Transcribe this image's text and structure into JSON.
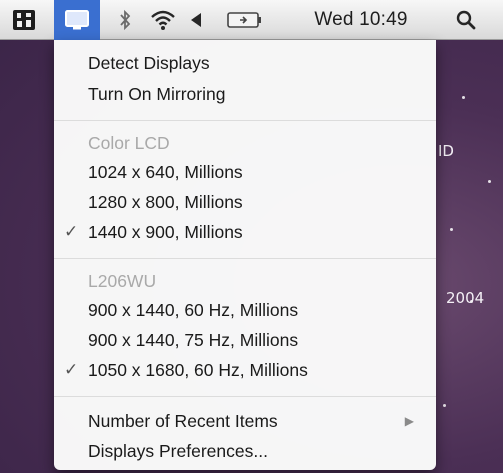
{
  "menubar": {
    "icons": {
      "app_icon": "dashboard-icon",
      "displays_icon": "display-icon",
      "bluetooth_icon": "bluetooth-icon",
      "wifi_icon": "wifi-icon",
      "volume_icon": "volume-icon",
      "battery_icon": "battery-charging-icon",
      "search_icon": "spotlight-search-icon"
    },
    "clock": "Wed 10:49"
  },
  "desktop": {
    "text_fragment_1": "ID",
    "text_fragment_2": "2004"
  },
  "menu": {
    "actions": [
      {
        "label": "Detect Displays"
      },
      {
        "label": "Turn On Mirroring"
      }
    ],
    "display_1": {
      "header": "Color LCD",
      "resolutions": [
        {
          "label": "1024 x 640, Millions",
          "checked": false
        },
        {
          "label": "1280 x 800, Millions",
          "checked": false
        },
        {
          "label": "1440 x 900, Millions",
          "checked": true
        }
      ]
    },
    "display_2": {
      "header": "L206WU",
      "resolutions": [
        {
          "label": "900 x 1440, 60 Hz, Millions",
          "checked": false
        },
        {
          "label": "900 x 1440, 75 Hz, Millions",
          "checked": false
        },
        {
          "label": "1050 x 1680, 60 Hz, Millions",
          "checked": true
        }
      ]
    },
    "footer": [
      {
        "label": "Number of Recent Items",
        "submenu": true
      },
      {
        "label": "Displays Preferences..."
      }
    ],
    "check_glyph": "✓",
    "submenu_glyph": "▶"
  },
  "colors": {
    "menubar_bg": "#e6e6e6",
    "menu_bg": "#fafafa",
    "header_text": "#a9a9a9",
    "selected_icon": "#3a6fd0",
    "desktop_bg": "#4b2f55"
  }
}
